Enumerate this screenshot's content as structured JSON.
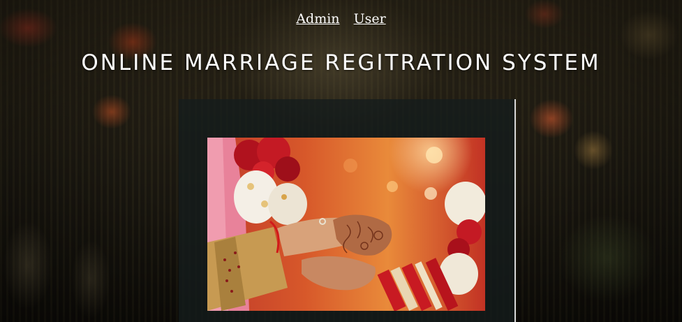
{
  "nav": {
    "links": [
      {
        "label": "Admin"
      },
      {
        "label": "User"
      }
    ]
  },
  "header": {
    "title": "ONLINE MARRIAGE REGITRATION SYSTEM"
  },
  "colors": {
    "title_text": "#ffffff",
    "nav_link": "#ffffff",
    "panel_background": "#141c1c"
  },
  "image": {
    "semantic": "wedding-hands-photo"
  }
}
